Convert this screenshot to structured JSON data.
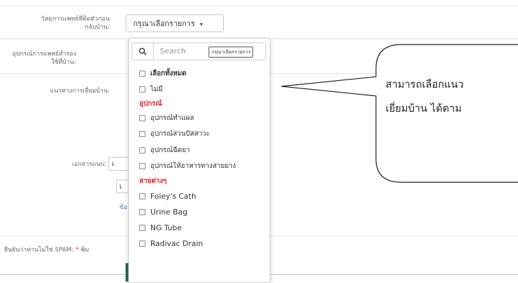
{
  "form": {
    "field1_label_line1": "วัสดุการแพทย์ที่ติดตัวก่อน",
    "field1_label_line2": "กลับบ้าน:",
    "field2_label_line1": "อุปกรณ์การแพทย์สำรอง",
    "field2_label_line2": "ใช้ที่บ้าน:",
    "field3_label": "แนวทางการเยี่ยมบ้าน:",
    "doc_label": "เอกสารแนบ:",
    "doc_stub1": "เ",
    "doc_stub2": "เ",
    "doc_link_stub": "ข้อ",
    "captcha_label": "ยืนยันว่าท่านไม่ใช่ SPAM:",
    "captcha_required": "*",
    "captcha_stub": "พิม"
  },
  "select": {
    "value": "กรุณาเลือกรายการ",
    "caret": "▾"
  },
  "dropdown": {
    "search_placeholder": "Search",
    "search_tag": "กรุณาเลือกรายการ",
    "select_all": "เลือกทั้งหมด",
    "none": "ไม่มี",
    "group1": "อุปกรณ์",
    "group1_items": [
      "อุปกรณ์ทำแผล",
      "อุปกรณ์สวนปัสสาวะ",
      "อุปกรณ์ฉีดยา",
      "อุปกรณ์ให้อาหารทางสายยาง"
    ],
    "group2": "สายต่างๆ",
    "group2_items": [
      "Foley's Cath",
      "Urine Bag",
      "NG Tube",
      "Radivac Drain"
    ]
  },
  "callout": {
    "line1": "สามารถเลือกแนว",
    "line2": "เยี่ยมบ้าน ได้ตาม"
  },
  "icons": {
    "search": "search-icon",
    "caret": "chevron-down-icon"
  },
  "colors": {
    "group_heading": "#e0202a",
    "link": "#2a6ebb",
    "submit": "#2d6b4f"
  }
}
